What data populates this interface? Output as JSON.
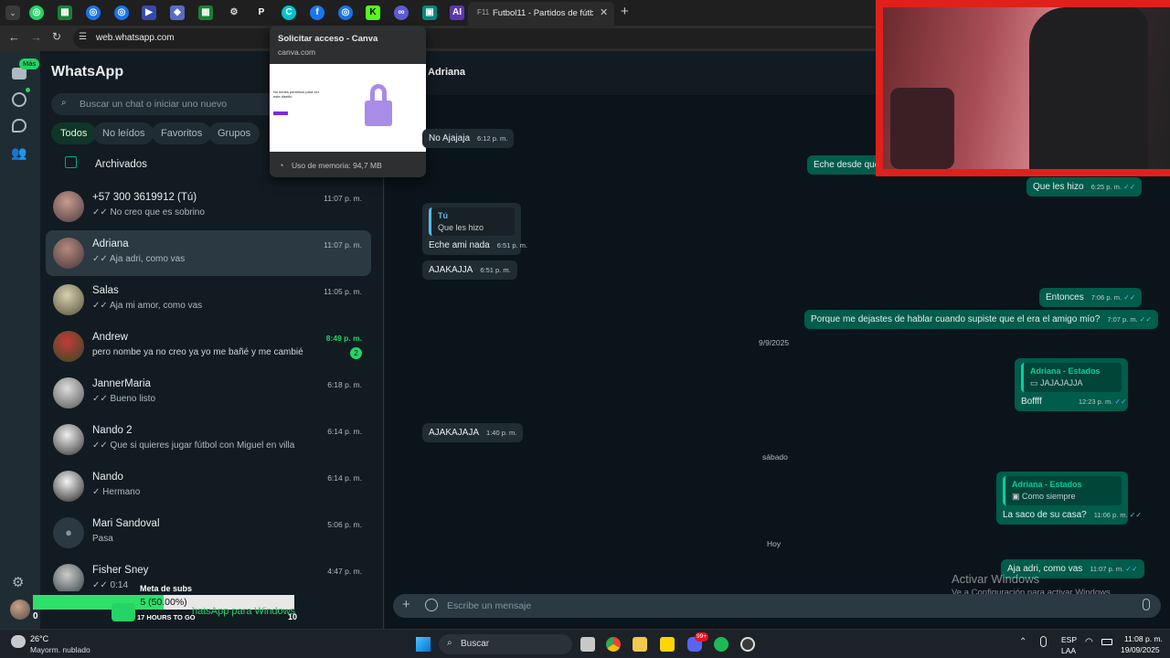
{
  "browser": {
    "active_tab_title": "Futbol11 - Partidos de fútbol d",
    "url": "web.whatsapp.com",
    "tab_icons": [
      "whatsapp-icon",
      "sheets-icon",
      "chrome-icon",
      "chrome-icon",
      "video-icon",
      "shield-icon",
      "sheets-icon",
      "gear-icon",
      "p-icon",
      "canva-icon",
      "facebook-icon",
      "chrome-icon",
      "k-icon",
      "link-icon",
      "photo-icon",
      "ai-icon"
    ]
  },
  "tooltip": {
    "title": "Solicitar acceso - Canva",
    "domain": "canva.com",
    "memory": "Uso de memoria: 94,7 MB",
    "preview_heading": "No tienes permisos para ver este diseño"
  },
  "rail": {
    "badge": "Más"
  },
  "sidebar": {
    "title": "WhatsApp",
    "search_placeholder": "Buscar un chat o iniciar uno nuevo",
    "filters": [
      "Todos",
      "No leídos",
      "Favoritos",
      "Grupos"
    ],
    "archived": "Archivados",
    "chats": [
      {
        "name": "+57 300 3619912 (Tú)",
        "preview": "✓✓ No creo que es sobrino",
        "time": "11:07 p. m."
      },
      {
        "name": "Adriana",
        "preview": "✓✓ Aja adri, como vas",
        "time": "11:07 p. m."
      },
      {
        "name": "Salas",
        "preview": "✓✓ Aja mi amor, como vas",
        "time": "11:05 p. m."
      },
      {
        "name": "Andrew",
        "preview": "pero nombe ya no creo ya yo me bañé y me cambié",
        "time": "8:49 p. m.",
        "unread": "2"
      },
      {
        "name": "JannerMaria",
        "preview": "✓✓ Bueno listo",
        "time": "6:18 p. m."
      },
      {
        "name": "Nando 2",
        "preview": "✓✓ Que si quieres jugar fútbol con Miguel en villa",
        "time": "6:14 p. m."
      },
      {
        "name": "Nando",
        "preview": "✓ Hermano",
        "time": "6:14 p. m."
      },
      {
        "name": "Mari Sandoval",
        "preview": "Pasa",
        "time": "5:06 p. m."
      },
      {
        "name": "Fisher Sney",
        "preview": "✓✓ 0:14",
        "time": "4:47 p. m."
      }
    ]
  },
  "overlay": {
    "goal_label": "Meta de subs",
    "goal_value": "5 (50.00%)",
    "goal_progress": 0.5,
    "left_num": "0",
    "right_num": "10",
    "hours_left": "17 HOURS TO GO",
    "banner_text": "hatsApp para Windows"
  },
  "chat": {
    "contact": "Adriana",
    "composer_placeholder": "Escribe un mensaje",
    "dates": [
      "9/9/2025",
      "sábado",
      "Hoy"
    ],
    "messages": [
      {
        "text": "No Ajajaja",
        "time": "6:12 p. m."
      },
      {
        "text": "Eche desde que",
        "time": ""
      },
      {
        "text": "Que les hizo",
        "time": "6:25 p. m."
      },
      {
        "quote_name": "Tú",
        "quote_text": "Que les hizo",
        "text": "Eche ami nada",
        "time": "6:51 p. m."
      },
      {
        "text": "AJAKAJJA",
        "time": "6:51 p. m."
      },
      {
        "text": "Entonces",
        "time": "7:06 p. m."
      },
      {
        "text": "Porque me dejastes de hablar cuando supiste que el era el amigo mío?",
        "time": "7:07 p. m."
      },
      {
        "quote_name": "Adriana - Estados",
        "quote_text": "JAJAJAJJA",
        "text": "Boffff",
        "time": "12:23 p. m."
      },
      {
        "text": "AJAKAJAJA",
        "time": "1:40 p. m."
      },
      {
        "quote_name": "Adriana - Estados",
        "quote_text": "Como siempre",
        "text": "La saco de su casa?",
        "time": "11:06 p. m."
      },
      {
        "text": "Aja adri, como vas",
        "time": "11:07 p. m."
      }
    ],
    "activate_title": "Activar Windows",
    "activate_sub": "Ve a Configuración para activar Windows."
  },
  "taskbar": {
    "weather_temp": "26°C",
    "weather_desc": "Mayorm. nublado",
    "search_label": "Buscar",
    "lang_top": "ESP",
    "lang_bottom": "LAA",
    "clock_time": "11:08 p. m.",
    "clock_date": "19/09/2025",
    "badge": "99+"
  },
  "colors": {
    "accent": "#00a884",
    "bubble_out": "#005c4b",
    "bubble_in": "#202c33",
    "stream_red": "#e0201c"
  }
}
